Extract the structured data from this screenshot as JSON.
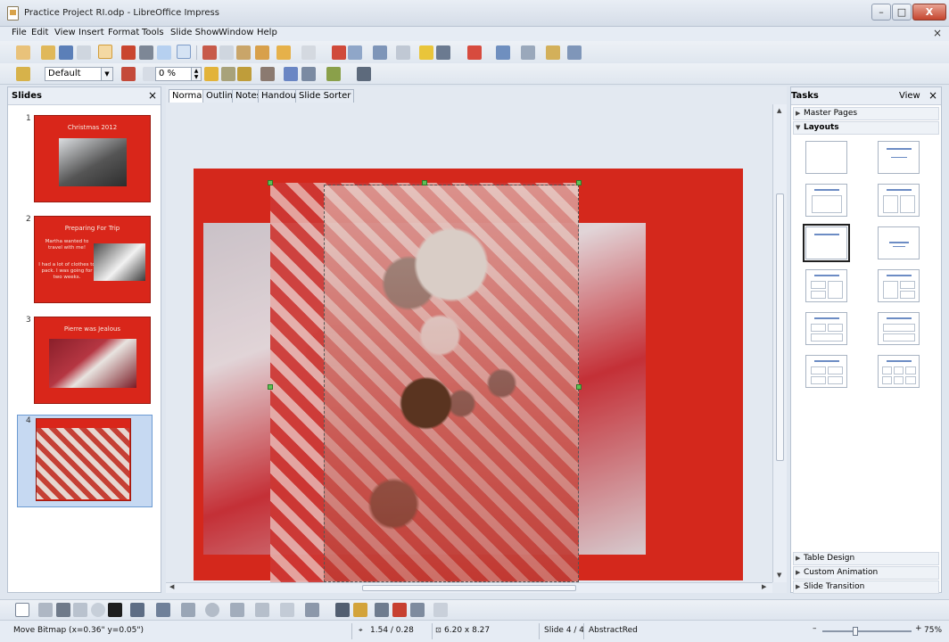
{
  "window": {
    "title": "Practice Project RI.odp - LibreOffice Impress",
    "min_glyph": "–",
    "max_glyph": "□",
    "close_glyph": "X"
  },
  "menu": {
    "items": [
      "File",
      "Edit",
      "View",
      "Insert",
      "Format",
      "Tools",
      "Slide Show",
      "Window",
      "Help"
    ],
    "close_glyph": "×"
  },
  "toolbar": {
    "style_value": "Default",
    "transparency_value": "0 %"
  },
  "slides_panel": {
    "title": "Slides",
    "close_glyph": "×",
    "slides": [
      {
        "number": "1",
        "title": "Christmas 2012",
        "lines": []
      },
      {
        "number": "2",
        "title": "Preparing For Trip",
        "lines": [
          "Martha wanted to travel with me!",
          "I had a lot of clothes to pack. I was going for two weeks."
        ]
      },
      {
        "number": "3",
        "title": "Pierre was Jealous",
        "lines": []
      },
      {
        "number": "4",
        "title": "",
        "lines": []
      }
    ]
  },
  "view_tabs": [
    "Normal",
    "Outline",
    "Notes",
    "Handout",
    "Slide Sorter"
  ],
  "tasks_panel": {
    "title": "Tasks",
    "view_label": "View",
    "close_glyph": "×",
    "sections_top": [
      "Master Pages",
      "Layouts"
    ],
    "sections_bottom": [
      "Table Design",
      "Custom Animation",
      "Slide Transition"
    ]
  },
  "statusbar": {
    "action": "Move Bitmap (x=0.36\" y=0.05\")",
    "position": "1.54 / 0.28",
    "size": "6.20 x 8.27",
    "slide": "Slide 4 / 4",
    "master": "AbstractRed",
    "zoom": "75%"
  },
  "colors": {
    "slide_background": "#d4281c",
    "accent_blue": "#6c8cc4"
  }
}
